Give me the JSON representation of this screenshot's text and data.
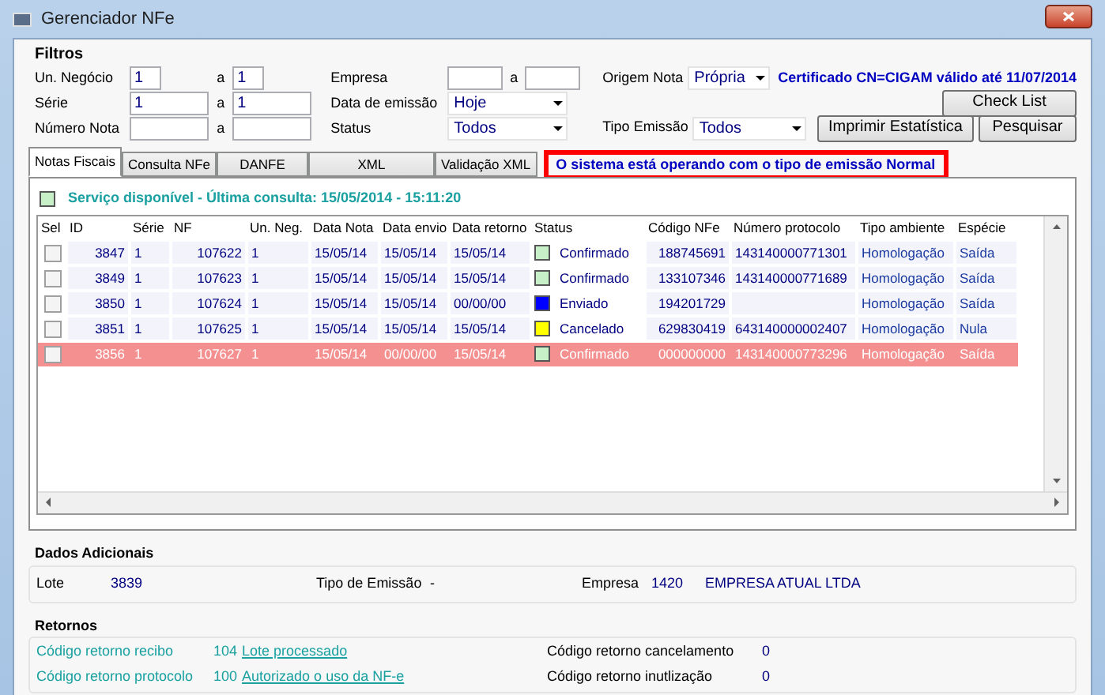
{
  "window": {
    "title": "Gerenciador NFe"
  },
  "filters": {
    "title": "Filtros",
    "ranges": [
      {
        "label": "Un. Negócio",
        "from": "1",
        "separator": "a",
        "to": "1"
      },
      {
        "label": "Série",
        "from": "1",
        "separator": "a",
        "to": "1"
      },
      {
        "label": "Número Nota",
        "separator": "a"
      }
    ],
    "empresa": {
      "label": "Empresa",
      "separator": "a"
    },
    "dropdowns": [
      {
        "label": "Data de emissão",
        "value": "Hoje"
      },
      {
        "label": "Status",
        "value": "Todos"
      }
    ],
    "origem": {
      "label": "Origem Nota",
      "value": "Própria"
    },
    "tipo_emissao": {
      "label": "Tipo Emissão",
      "value": "Todos"
    },
    "certificate": "Certificado CN=CIGAM válido até 11/07/2014"
  },
  "buttons": {
    "check_list": "Check List",
    "print": "Imprimir Estatística",
    "search": "Pesquisar"
  },
  "tabs": [
    {
      "label": "Notas Fiscais",
      "selected": true
    },
    {
      "label": "Consulta NFe",
      "selected": false
    },
    {
      "label": "DANFE",
      "selected": false
    },
    {
      "label": "XML",
      "selected": false
    },
    {
      "label": "Validação XML",
      "selected": false
    }
  ],
  "notice": "O sistema está operando com o tipo de emissão Normal",
  "service": {
    "text": "Serviço disponível - Última consulta: 15/05/2014 - 15:11:20",
    "color": "#c8f0c8"
  },
  "table": {
    "columns": [
      "Sel",
      "ID",
      "Série",
      "NF",
      "Un. Neg.",
      "Data Nota",
      "Data envio",
      "Data retorno",
      "Status",
      "Código NFe",
      "Número protocolo",
      "Tipo ambiente",
      "Espécie"
    ],
    "rows": [
      {
        "checked": false,
        "selected": false,
        "id": "3847",
        "serie": "1",
        "nf": "107622",
        "un_neg": "1",
        "data_nota": "15/05/14",
        "data_envio": "15/05/14",
        "data_retorno": "15/05/14",
        "status": "Confirmado",
        "color": "#c8f0c8",
        "codigo": "188745691",
        "protocolo": "143140000771301",
        "ambiente": "Homologação",
        "especie": "Saída"
      },
      {
        "checked": false,
        "selected": false,
        "id": "3849",
        "serie": "1",
        "nf": "107623",
        "un_neg": "1",
        "data_nota": "15/05/14",
        "data_envio": "15/05/14",
        "data_retorno": "15/05/14",
        "status": "Confirmado",
        "color": "#c8f0c8",
        "codigo": "133107346",
        "protocolo": "143140000771689",
        "ambiente": "Homologação",
        "especie": "Saída"
      },
      {
        "checked": false,
        "selected": false,
        "id": "3850",
        "serie": "1",
        "nf": "107624",
        "un_neg": "1",
        "data_nota": "15/05/14",
        "data_envio": "15/05/14",
        "data_retorno": "00/00/00",
        "status": "Enviado",
        "color": "#0000ff",
        "codigo": "194201729",
        "ambiente": "Homologação",
        "especie": "Saída"
      },
      {
        "checked": false,
        "selected": false,
        "id": "3851",
        "serie": "1",
        "nf": "107625",
        "un_neg": "1",
        "data_nota": "15/05/14",
        "data_envio": "15/05/14",
        "data_retorno": "15/05/14",
        "status": "Cancelado",
        "color": "#ffff00",
        "codigo": "629830419",
        "protocolo": "643140000002407",
        "ambiente": "Homologação",
        "especie": "Nula"
      },
      {
        "checked": false,
        "selected": true,
        "id": "3856",
        "serie": "1",
        "nf": "107627",
        "un_neg": "1",
        "data_nota": "15/05/14",
        "data_envio": "00/00/00",
        "data_retorno": "15/05/14",
        "status": "Confirmado",
        "color": "#c8f0c8",
        "codigo": "000000000",
        "protocolo": "143140000773296",
        "ambiente": "Homologação",
        "especie": "Saída"
      }
    ]
  },
  "dados": {
    "title": "Dados Adicionais",
    "lote_label": "Lote",
    "lote": "3839",
    "tipo_label": "Tipo de Emissão",
    "tipo": "-",
    "empresa_label": "Empresa",
    "empresa_code": "1420",
    "empresa_name": "EMPRESA ATUAL LTDA"
  },
  "retornos": {
    "title": "Retornos",
    "left": [
      {
        "label": "Código retorno recibo",
        "code": "104",
        "link": "Lote processado"
      },
      {
        "label": "Código retorno protocolo",
        "code": "100",
        "link": "Autorizado o uso da NF-e"
      }
    ],
    "right": [
      {
        "label": "Código retorno cancelamento",
        "code": "0"
      },
      {
        "label": "Código retorno inutlização",
        "code": "0"
      }
    ]
  }
}
